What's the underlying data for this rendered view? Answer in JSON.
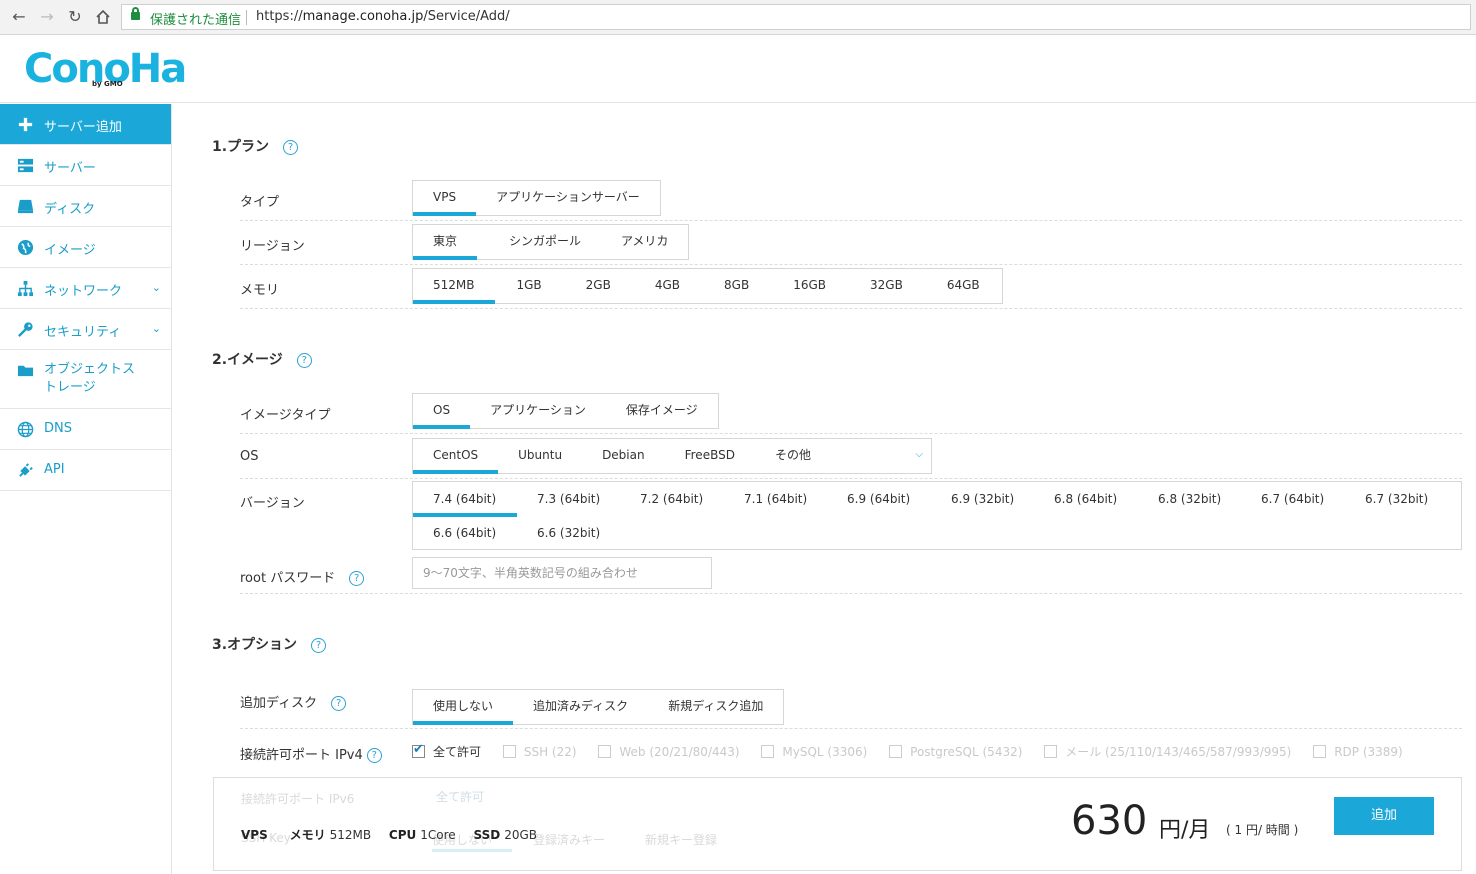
{
  "browser": {
    "secure_label": "保護された通信",
    "url_prefix": "https://",
    "url_host": "manage.conoha.jp",
    "url_path": "/Service/Add/"
  },
  "logo": {
    "text": "ConoHa",
    "sub": "by GMO"
  },
  "sidebar": {
    "items": [
      {
        "label": "サーバー追加"
      },
      {
        "label": "サーバー"
      },
      {
        "label": "ディスク"
      },
      {
        "label": "イメージ"
      },
      {
        "label": "ネットワーク"
      },
      {
        "label": "セキュリティ"
      },
      {
        "label": "オブジェクトストレージ"
      },
      {
        "label": "DNS"
      },
      {
        "label": "API"
      }
    ]
  },
  "plan": {
    "title": "1.プラン",
    "type_label": "タイプ",
    "type_options": [
      "VPS",
      "アプリケーションサーバー"
    ],
    "region_label": "リージョン",
    "region_options": [
      "東京",
      "シンガポール",
      "アメリカ"
    ],
    "memory_label": "メモリ",
    "memory_options": [
      "512MB",
      "1GB",
      "2GB",
      "4GB",
      "8GB",
      "16GB",
      "32GB",
      "64GB"
    ]
  },
  "image": {
    "title": "2.イメージ",
    "type_label": "イメージタイプ",
    "type_options": [
      "OS",
      "アプリケーション",
      "保存イメージ"
    ],
    "os_label": "OS",
    "os_options": [
      "CentOS",
      "Ubuntu",
      "Debian",
      "FreeBSD",
      "その他"
    ],
    "version_label": "バージョン",
    "versions": [
      "7.4 (64bit)",
      "7.3 (64bit)",
      "7.2 (64bit)",
      "7.1 (64bit)",
      "6.9 (64bit)",
      "6.9 (32bit)",
      "6.8 (64bit)",
      "6.8 (32bit)",
      "6.7 (64bit)",
      "6.7 (32bit)",
      "6.6 (64bit)",
      "6.6 (32bit)"
    ],
    "password_label": "root パスワード",
    "password_placeholder": "9～70文字、半角英数記号の組み合わせ"
  },
  "option": {
    "title": "3.オプション",
    "disk_label": "追加ディスク",
    "disk_options": [
      "使用しない",
      "追加済みディスク",
      "新規ディスク追加"
    ],
    "ipv4_label": "接続許可ポート IPv4",
    "ipv6_label": "接続許可ポート IPv6",
    "ports": [
      "全て許可",
      "SSH (22)",
      "Web (20/21/80/443)",
      "MySQL (3306)",
      "PostgreSQL (5432)",
      "メール (25/110/143/465/587/993/995)",
      "RDP (3389)"
    ],
    "sshkey_label": "SSH Key",
    "sshkey_options": [
      "使用しない",
      "登録済みキー",
      "新規キー登録"
    ]
  },
  "summary": {
    "vps_label": "VPS",
    "memory_label": "メモリ",
    "memory_value": "512MB",
    "cpu_label": "CPU",
    "cpu_value": "1Core",
    "ssd_label": "SSD",
    "ssd_value": "20GB",
    "price": "630",
    "price_unit": "円/月",
    "hourly": "( 1 円/ 時間 )",
    "add_button": "追加"
  },
  "colors": {
    "accent": "#1ba8d9",
    "link": "#1a9dc9",
    "secure": "#1e8e3e"
  }
}
